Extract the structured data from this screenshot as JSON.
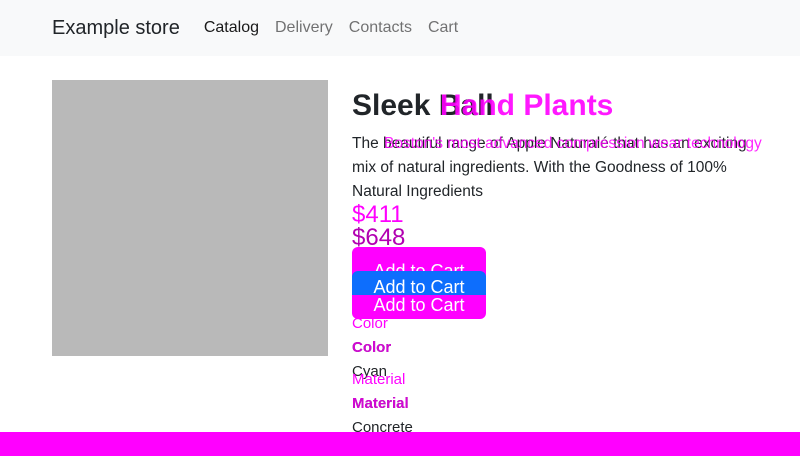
{
  "header": {
    "brand": "Example store",
    "nav": [
      {
        "label": "Catalog",
        "active": true
      },
      {
        "label": "Delivery",
        "active": false
      },
      {
        "label": "Contacts",
        "active": false
      },
      {
        "label": "Cart",
        "active": false
      }
    ]
  },
  "product": {
    "title_base": "Sleek Ball",
    "title_ghost": "Hand Plants",
    "description_base": "The beautiful range of Apple Naturalé that has an exciting mix of natural ingredients. With the Goodness of 100% Natural Ingredients",
    "description_ghost": "Boston's most advanced compression wear technology",
    "prices": [
      "$411",
      "$648"
    ],
    "add_to_cart_label": "Add to Cart",
    "attributes": {
      "color_label": "Color",
      "color_value": "Cyan",
      "material_label": "Material",
      "material_value": "Concrete"
    }
  },
  "colors": {
    "accent_magenta": "#ff00ff",
    "primary_blue": "#0d6efd",
    "image_placeholder": "#b9b9b9"
  }
}
